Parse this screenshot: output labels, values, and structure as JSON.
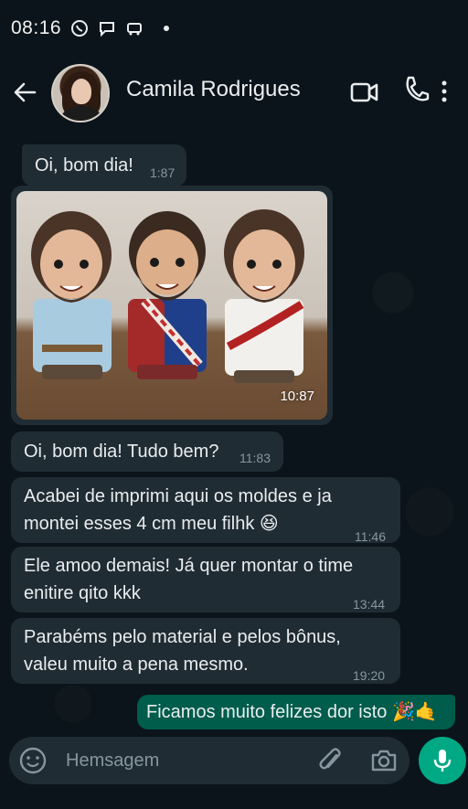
{
  "status_bar": {
    "time": "08:16"
  },
  "header": {
    "contact_name": "Camila Rodrigues"
  },
  "messages": [
    {
      "text": "Oi, bom dia!",
      "time": "1:87"
    },
    {
      "type": "image",
      "time": "10:87"
    },
    {
      "text": "Oi, bom dia! Tudo bem?",
      "time": "11:83"
    },
    {
      "text": "Acabei de imprimi aqui os moldes e ja montei esses 4 cm meu filhk 😆",
      "time": "11:46"
    },
    {
      "text": "Ele amoo demais! Já quer montar o time enitire qito kkk",
      "time": "13:44"
    },
    {
      "text": "Parabéms pelo material e pelos bônus, valeu muito a pena mesmo.",
      "time": "19:20"
    },
    {
      "text": "Ficamos muito felizes dor isto 🎉🤙",
      "outgoing": true
    }
  ],
  "composer": {
    "placeholder": "Hemsagem"
  },
  "colors": {
    "accent": "#00a884",
    "outgoing_bubble": "#005c4b",
    "incoming_bubble": "#202c33",
    "background": "#0b141a"
  }
}
